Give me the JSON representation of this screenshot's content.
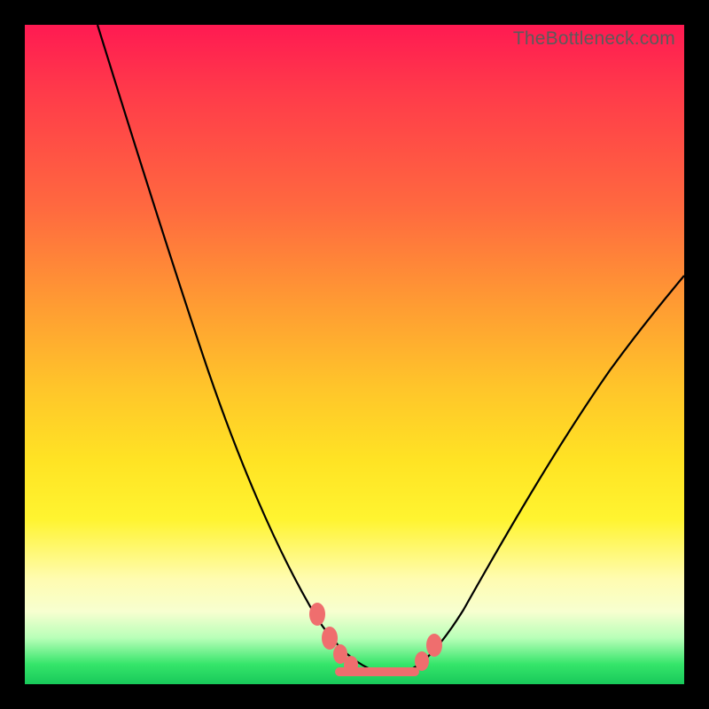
{
  "watermark": "TheBottleneck.com",
  "colors": {
    "gradient_top": "#ff1a52",
    "gradient_bottom": "#18c95a",
    "curve": "#000000",
    "marker": "#ef6e6e",
    "frame": "#000000"
  },
  "chart_data": {
    "type": "line",
    "title": "",
    "xlabel": "",
    "ylabel": "",
    "xlim": [
      0,
      100
    ],
    "ylim": [
      0,
      100
    ],
    "grid": false,
    "legend": false,
    "series": [
      {
        "name": "left-curve",
        "x": [
          11,
          15,
          20,
          25,
          30,
          35,
          40,
          44,
          46,
          48,
          50,
          52,
          54
        ],
        "y": [
          100,
          88,
          74,
          60,
          46,
          33,
          21,
          12,
          9,
          6,
          4,
          2.5,
          2
        ]
      },
      {
        "name": "right-curve",
        "x": [
          56,
          58,
          60,
          62,
          65,
          70,
          75,
          80,
          85,
          90,
          95,
          100
        ],
        "y": [
          2,
          2.5,
          4,
          6,
          10,
          17,
          25,
          33,
          41,
          48,
          55,
          62
        ]
      },
      {
        "name": "trough-flat",
        "x": [
          47,
          60
        ],
        "y": [
          1.8,
          1.8
        ]
      }
    ],
    "markers": [
      {
        "series": "left-curve",
        "x": 44,
        "y": 12
      },
      {
        "series": "left-curve",
        "x": 46.5,
        "y": 8
      },
      {
        "series": "left-curve",
        "x": 48,
        "y": 5.5
      },
      {
        "series": "left-curve",
        "x": 49.5,
        "y": 3.5
      },
      {
        "series": "right-curve",
        "x": 60,
        "y": 4
      },
      {
        "series": "right-curve",
        "x": 62,
        "y": 6.5
      }
    ]
  }
}
